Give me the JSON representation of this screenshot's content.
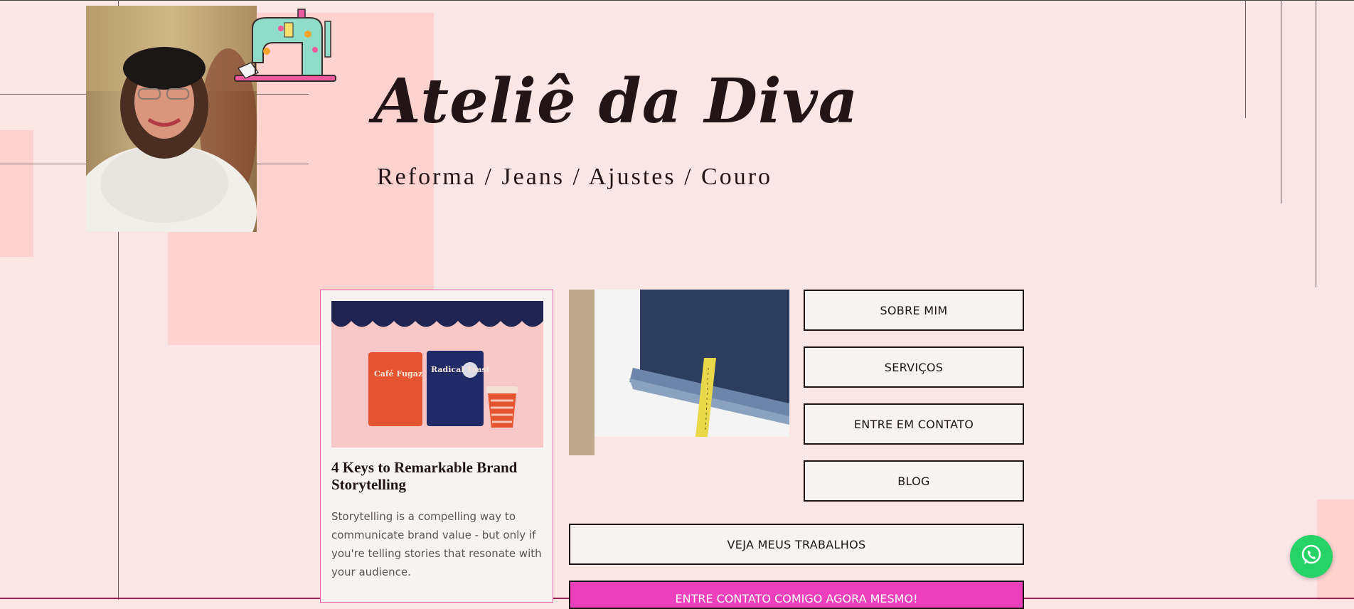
{
  "brand": {
    "title": "Ateliê da Diva",
    "subtitle": "Reforma / Jeans / Ajustes / Couro"
  },
  "blog_card": {
    "title": "4 Keys to Remarkable Brand Storytelling",
    "excerpt": "Storytelling is a compelling way to communicate brand value - but only if you're telling stories that resonate with your audience.",
    "image_labels": {
      "bag1": "Café Fugaz",
      "bag2": "Radical Toast"
    }
  },
  "nav": {
    "about": "SOBRE MIM",
    "services": "SERVIÇOS",
    "contact": "ENTRE EM CONTATO",
    "blog": "BLOG"
  },
  "works_button": "VEJA MEUS TRABALHOS",
  "cta_button": "ENTRE CONTATO COMIGO AGORA MESMO!",
  "colors": {
    "background": "#fbe6e6",
    "pink_block": "#fdd2cf",
    "accent_pink": "#ee3fbd",
    "whatsapp": "#25d366",
    "text_dark": "#231517"
  },
  "icons": {
    "whatsapp": "whatsapp-icon",
    "sewing_machine": "sewing-machine-icon"
  }
}
